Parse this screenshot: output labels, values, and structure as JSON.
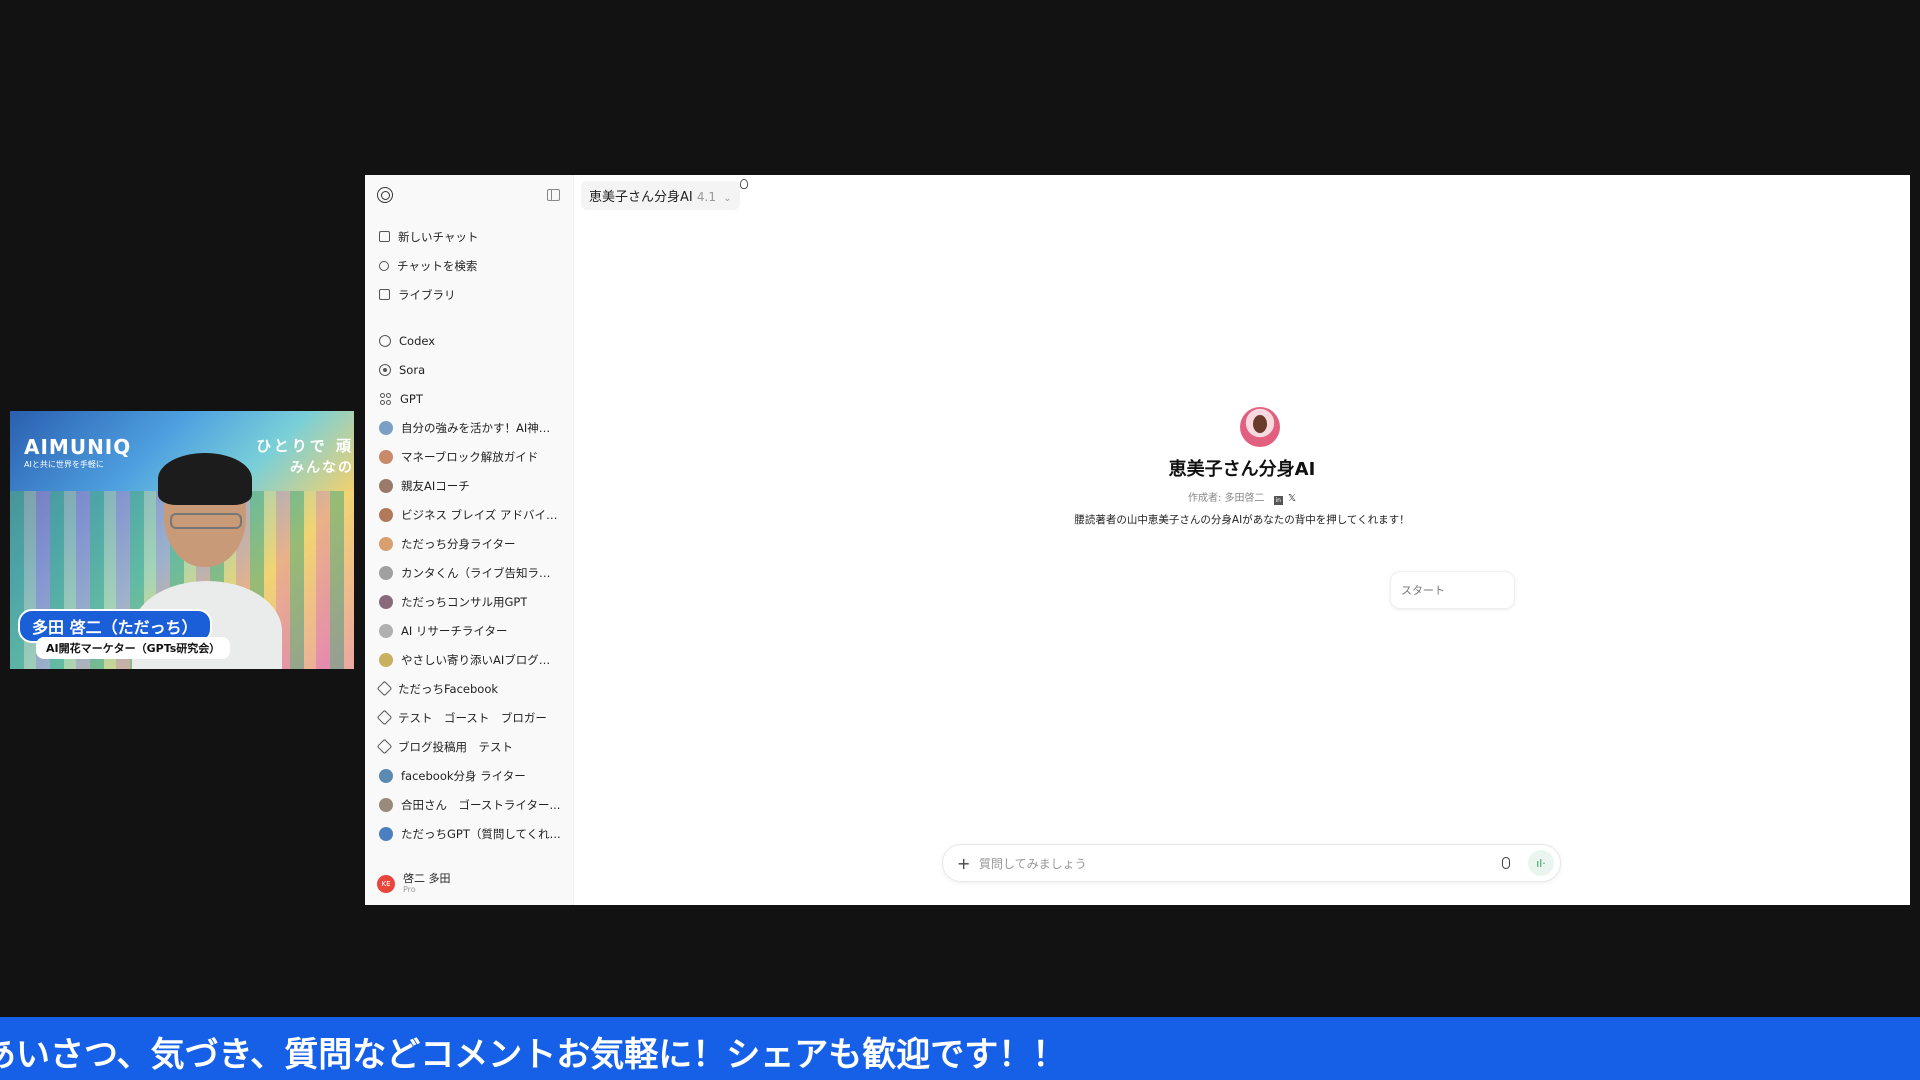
{
  "webcam": {
    "brand": "AIMUNIQ",
    "brand_sub": "AIと共に世界を手軽に",
    "tagline_1": "ひとりで 頑",
    "tagline_2": "みんなの",
    "presenter_name": "多田 啓二（ただっち）",
    "presenter_role": "AI開花マーケター（GPTs研究会）"
  },
  "sidebar": {
    "actions": [
      {
        "icon": "new-chat-icon",
        "label": "新しいチャット"
      },
      {
        "icon": "search-icon",
        "label": "チャットを検索"
      },
      {
        "icon": "library-icon",
        "label": "ライブラリ"
      }
    ],
    "apps": [
      {
        "icon": "codex-icon",
        "label": "Codex"
      },
      {
        "icon": "sora-icon",
        "label": "Sora"
      },
      {
        "icon": "gpt-grid-icon",
        "label": "GPT"
      }
    ],
    "gpts": [
      {
        "label": "自分の強みを活かす！AI神様...",
        "color": "#7aa0c8"
      },
      {
        "label": "マネーブロック解放ガイド",
        "color": "#c88a6a"
      },
      {
        "label": "親友AIコーチ",
        "color": "#9a7a6a"
      },
      {
        "label": "ビジネス ブレイズ アドバイザ...",
        "color": "#b07a5a"
      },
      {
        "label": "ただっち分身ライター",
        "color": "#d8a070"
      },
      {
        "label": "カンタくん（ライブ告知ライ...",
        "color": "#a0a0a0"
      },
      {
        "label": "ただっちコンサル用GPT",
        "color": "#8a6a7a"
      },
      {
        "label": "AI リサーチライター",
        "color": "#b0b0b0"
      },
      {
        "label": "やさしい寄り添いAIブログラ...",
        "color": "#c8b060"
      },
      {
        "label": "ただっちFacebook",
        "color": "cube"
      },
      {
        "label": "テスト　ゴースト　ブロガー",
        "color": "cube"
      },
      {
        "label": "ブログ投稿用　テスト",
        "color": "cube"
      },
      {
        "label": "facebook分身 ライター",
        "color": "#5a8ab0"
      },
      {
        "label": "合田さん　ゴーストライター...",
        "color": "#9a8a7a"
      },
      {
        "label": "ただっちGPT（質問してくれ...",
        "color": "#4a80c0"
      }
    ],
    "profile": {
      "initials": "KE",
      "name": "啓二 多田",
      "plan": "Pro"
    }
  },
  "header": {
    "model_name": "恵美子さん分身AI",
    "model_version": "4.1"
  },
  "gpt": {
    "name": "恵美子さん分身AI",
    "author": "作成者: 多田啓二",
    "social_linkedin": "in",
    "social_x": "𝕏",
    "description": "腰読著者の山中恵美子さんの分身AIがあなたの背中を押してくれます！",
    "start_label": "スタート"
  },
  "composer": {
    "placeholder": "質問してみましょう"
  },
  "ticker": {
    "text": "あいさつ、気づき、質問などコメントお気軽に！シェアも歓迎です！！"
  },
  "colors": {
    "ticker_bg": "#1560e6",
    "profile_avatar": "#e8453c"
  }
}
